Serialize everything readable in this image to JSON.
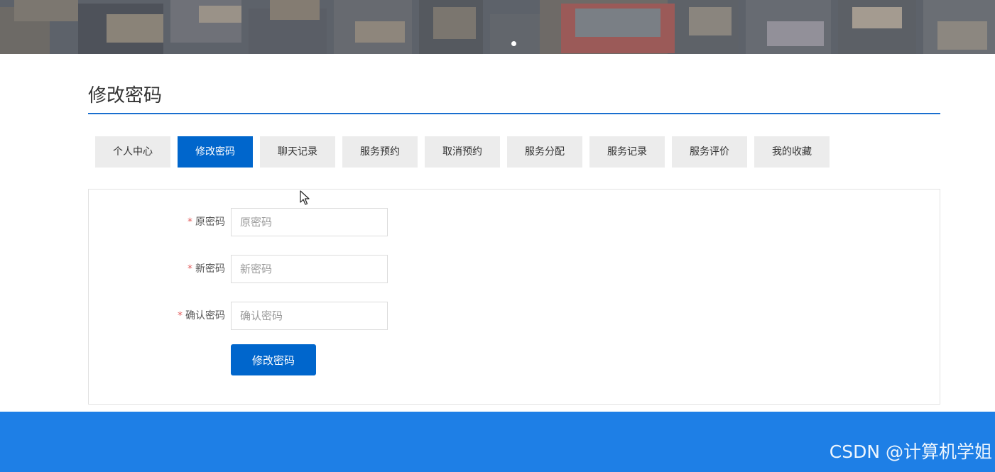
{
  "page": {
    "title": "修改密码"
  },
  "tabs": [
    {
      "label": "个人中心",
      "active": false
    },
    {
      "label": "修改密码",
      "active": true
    },
    {
      "label": "聊天记录",
      "active": false
    },
    {
      "label": "服务预约",
      "active": false
    },
    {
      "label": "取消预约",
      "active": false
    },
    {
      "label": "服务分配",
      "active": false
    },
    {
      "label": "服务记录",
      "active": false
    },
    {
      "label": "服务评价",
      "active": false
    },
    {
      "label": "我的收藏",
      "active": false
    }
  ],
  "form": {
    "required_mark": "*",
    "fields": [
      {
        "label": "原密码",
        "placeholder": "原密码",
        "value": ""
      },
      {
        "label": "新密码",
        "placeholder": "新密码",
        "value": ""
      },
      {
        "label": "确认密码",
        "placeholder": "确认密码",
        "value": ""
      }
    ],
    "submit_label": "修改密码"
  },
  "footer": {
    "watermark": "CSDN @计算机学姐"
  },
  "colors": {
    "accent": "#0066cc",
    "rule": "#1a6fcf",
    "footer": "#1e7fe6",
    "tab_bg": "#ececec",
    "required": "#e25c5c"
  },
  "icons": {
    "cursor": "mouse-pointer-icon",
    "banner_indicator": "carousel-dot-icon"
  }
}
